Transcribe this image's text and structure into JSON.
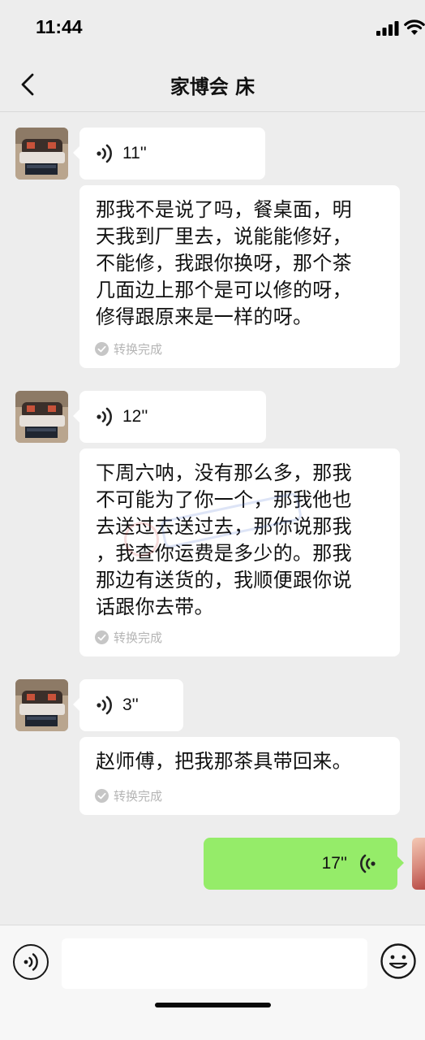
{
  "status_bar": {
    "time": "11:44"
  },
  "nav": {
    "title": "家博会 床"
  },
  "messages": [
    {
      "duration": "11''",
      "lines": [
        "那我不是说了吗，餐桌面，明",
        "天我到厂里去，说能能修好，",
        "不能修，我跟你换呀，那个茶",
        "几面边上那个是可以修的呀，",
        "修得跟原来是一样的呀。"
      ],
      "status": "转换完成"
    },
    {
      "duration": "12''",
      "lines": [
        "下周六呐，没有那么多，那我",
        "不可能为了你一个，那我他也",
        "去送过去送过去，那你说那我",
        "，我查你运费是多少的。那我",
        "那边有送货的，我顺便跟你说",
        "话跟你去带。"
      ],
      "status": "转换完成"
    },
    {
      "duration": "3''",
      "lines": [
        "赵师傅，把我那茶具带回来。"
      ],
      "status": "转换完成"
    }
  ],
  "outgoing": {
    "duration": "17''"
  },
  "colors": {
    "background": "#ededed",
    "outgoing_bubble": "#95ec69",
    "incoming_bubble": "#ffffff"
  }
}
